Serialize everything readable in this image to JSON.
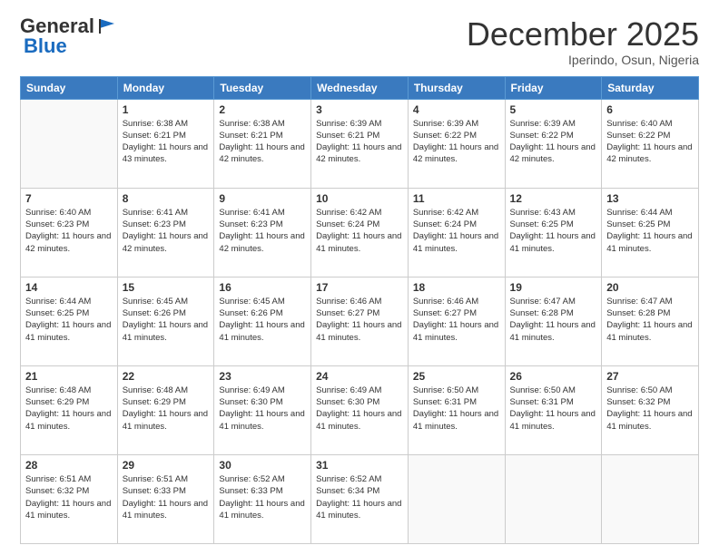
{
  "logo": {
    "general": "General",
    "blue": "Blue"
  },
  "header": {
    "month": "December 2025",
    "location": "Iperindo, Osun, Nigeria"
  },
  "weekdays": [
    "Sunday",
    "Monday",
    "Tuesday",
    "Wednesday",
    "Thursday",
    "Friday",
    "Saturday"
  ],
  "weeks": [
    [
      {
        "day": "",
        "sunrise": "",
        "sunset": "",
        "daylight": ""
      },
      {
        "day": "1",
        "sunrise": "Sunrise: 6:38 AM",
        "sunset": "Sunset: 6:21 PM",
        "daylight": "Daylight: 11 hours and 43 minutes."
      },
      {
        "day": "2",
        "sunrise": "Sunrise: 6:38 AM",
        "sunset": "Sunset: 6:21 PM",
        "daylight": "Daylight: 11 hours and 42 minutes."
      },
      {
        "day": "3",
        "sunrise": "Sunrise: 6:39 AM",
        "sunset": "Sunset: 6:21 PM",
        "daylight": "Daylight: 11 hours and 42 minutes."
      },
      {
        "day": "4",
        "sunrise": "Sunrise: 6:39 AM",
        "sunset": "Sunset: 6:22 PM",
        "daylight": "Daylight: 11 hours and 42 minutes."
      },
      {
        "day": "5",
        "sunrise": "Sunrise: 6:39 AM",
        "sunset": "Sunset: 6:22 PM",
        "daylight": "Daylight: 11 hours and 42 minutes."
      },
      {
        "day": "6",
        "sunrise": "Sunrise: 6:40 AM",
        "sunset": "Sunset: 6:22 PM",
        "daylight": "Daylight: 11 hours and 42 minutes."
      }
    ],
    [
      {
        "day": "7",
        "sunrise": "Sunrise: 6:40 AM",
        "sunset": "Sunset: 6:23 PM",
        "daylight": "Daylight: 11 hours and 42 minutes."
      },
      {
        "day": "8",
        "sunrise": "Sunrise: 6:41 AM",
        "sunset": "Sunset: 6:23 PM",
        "daylight": "Daylight: 11 hours and 42 minutes."
      },
      {
        "day": "9",
        "sunrise": "Sunrise: 6:41 AM",
        "sunset": "Sunset: 6:23 PM",
        "daylight": "Daylight: 11 hours and 42 minutes."
      },
      {
        "day": "10",
        "sunrise": "Sunrise: 6:42 AM",
        "sunset": "Sunset: 6:24 PM",
        "daylight": "Daylight: 11 hours and 41 minutes."
      },
      {
        "day": "11",
        "sunrise": "Sunrise: 6:42 AM",
        "sunset": "Sunset: 6:24 PM",
        "daylight": "Daylight: 11 hours and 41 minutes."
      },
      {
        "day": "12",
        "sunrise": "Sunrise: 6:43 AM",
        "sunset": "Sunset: 6:25 PM",
        "daylight": "Daylight: 11 hours and 41 minutes."
      },
      {
        "day": "13",
        "sunrise": "Sunrise: 6:44 AM",
        "sunset": "Sunset: 6:25 PM",
        "daylight": "Daylight: 11 hours and 41 minutes."
      }
    ],
    [
      {
        "day": "14",
        "sunrise": "Sunrise: 6:44 AM",
        "sunset": "Sunset: 6:25 PM",
        "daylight": "Daylight: 11 hours and 41 minutes."
      },
      {
        "day": "15",
        "sunrise": "Sunrise: 6:45 AM",
        "sunset": "Sunset: 6:26 PM",
        "daylight": "Daylight: 11 hours and 41 minutes."
      },
      {
        "day": "16",
        "sunrise": "Sunrise: 6:45 AM",
        "sunset": "Sunset: 6:26 PM",
        "daylight": "Daylight: 11 hours and 41 minutes."
      },
      {
        "day": "17",
        "sunrise": "Sunrise: 6:46 AM",
        "sunset": "Sunset: 6:27 PM",
        "daylight": "Daylight: 11 hours and 41 minutes."
      },
      {
        "day": "18",
        "sunrise": "Sunrise: 6:46 AM",
        "sunset": "Sunset: 6:27 PM",
        "daylight": "Daylight: 11 hours and 41 minutes."
      },
      {
        "day": "19",
        "sunrise": "Sunrise: 6:47 AM",
        "sunset": "Sunset: 6:28 PM",
        "daylight": "Daylight: 11 hours and 41 minutes."
      },
      {
        "day": "20",
        "sunrise": "Sunrise: 6:47 AM",
        "sunset": "Sunset: 6:28 PM",
        "daylight": "Daylight: 11 hours and 41 minutes."
      }
    ],
    [
      {
        "day": "21",
        "sunrise": "Sunrise: 6:48 AM",
        "sunset": "Sunset: 6:29 PM",
        "daylight": "Daylight: 11 hours and 41 minutes."
      },
      {
        "day": "22",
        "sunrise": "Sunrise: 6:48 AM",
        "sunset": "Sunset: 6:29 PM",
        "daylight": "Daylight: 11 hours and 41 minutes."
      },
      {
        "day": "23",
        "sunrise": "Sunrise: 6:49 AM",
        "sunset": "Sunset: 6:30 PM",
        "daylight": "Daylight: 11 hours and 41 minutes."
      },
      {
        "day": "24",
        "sunrise": "Sunrise: 6:49 AM",
        "sunset": "Sunset: 6:30 PM",
        "daylight": "Daylight: 11 hours and 41 minutes."
      },
      {
        "day": "25",
        "sunrise": "Sunrise: 6:50 AM",
        "sunset": "Sunset: 6:31 PM",
        "daylight": "Daylight: 11 hours and 41 minutes."
      },
      {
        "day": "26",
        "sunrise": "Sunrise: 6:50 AM",
        "sunset": "Sunset: 6:31 PM",
        "daylight": "Daylight: 11 hours and 41 minutes."
      },
      {
        "day": "27",
        "sunrise": "Sunrise: 6:50 AM",
        "sunset": "Sunset: 6:32 PM",
        "daylight": "Daylight: 11 hours and 41 minutes."
      }
    ],
    [
      {
        "day": "28",
        "sunrise": "Sunrise: 6:51 AM",
        "sunset": "Sunset: 6:32 PM",
        "daylight": "Daylight: 11 hours and 41 minutes."
      },
      {
        "day": "29",
        "sunrise": "Sunrise: 6:51 AM",
        "sunset": "Sunset: 6:33 PM",
        "daylight": "Daylight: 11 hours and 41 minutes."
      },
      {
        "day": "30",
        "sunrise": "Sunrise: 6:52 AM",
        "sunset": "Sunset: 6:33 PM",
        "daylight": "Daylight: 11 hours and 41 minutes."
      },
      {
        "day": "31",
        "sunrise": "Sunrise: 6:52 AM",
        "sunset": "Sunset: 6:34 PM",
        "daylight": "Daylight: 11 hours and 41 minutes."
      },
      {
        "day": "",
        "sunrise": "",
        "sunset": "",
        "daylight": ""
      },
      {
        "day": "",
        "sunrise": "",
        "sunset": "",
        "daylight": ""
      },
      {
        "day": "",
        "sunrise": "",
        "sunset": "",
        "daylight": ""
      }
    ]
  ]
}
